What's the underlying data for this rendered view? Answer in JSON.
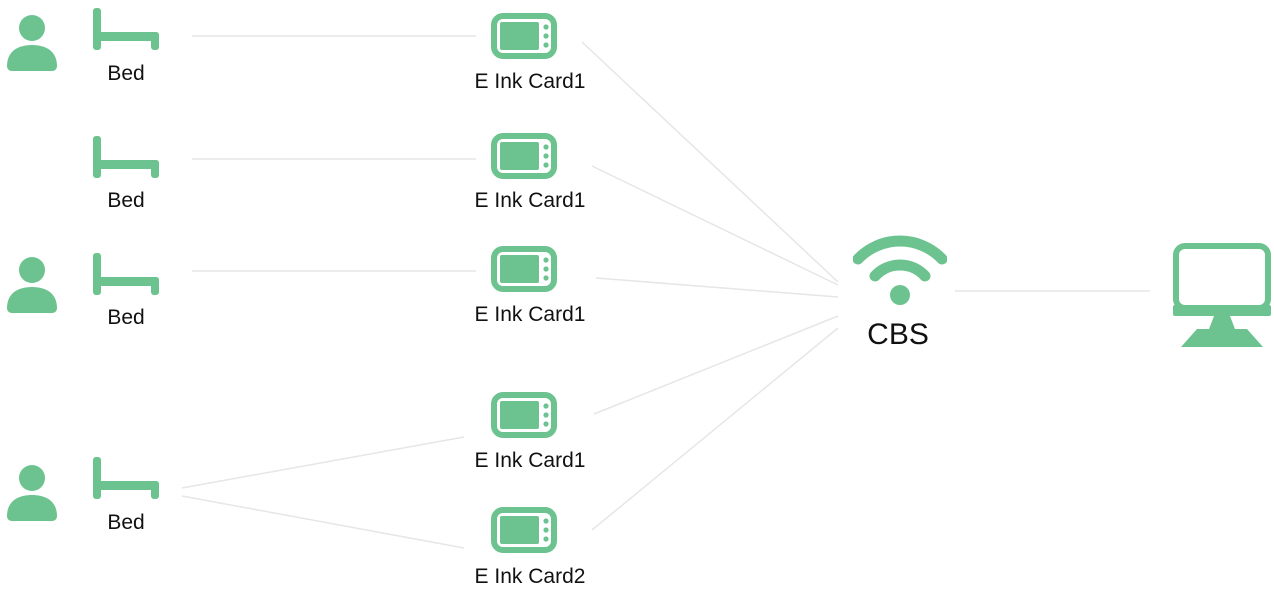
{
  "colors": {
    "icon": "#6dc38f",
    "line": "#e6e6e6",
    "text": "#111111"
  },
  "beds": [
    {
      "label": "Bed",
      "has_person": true
    },
    {
      "label": "Bed",
      "has_person": false
    },
    {
      "label": "Bed",
      "has_person": true
    },
    {
      "label": "Bed",
      "has_person": true
    }
  ],
  "cards": [
    {
      "label": "E Ink Card1"
    },
    {
      "label": "E Ink Card1"
    },
    {
      "label": "E Ink Card1"
    },
    {
      "label": "E Ink Card1"
    },
    {
      "label": "E Ink Card2"
    }
  ],
  "station": {
    "label": "CBS"
  },
  "computer": {
    "icon": "desktop-monitor-icon"
  }
}
